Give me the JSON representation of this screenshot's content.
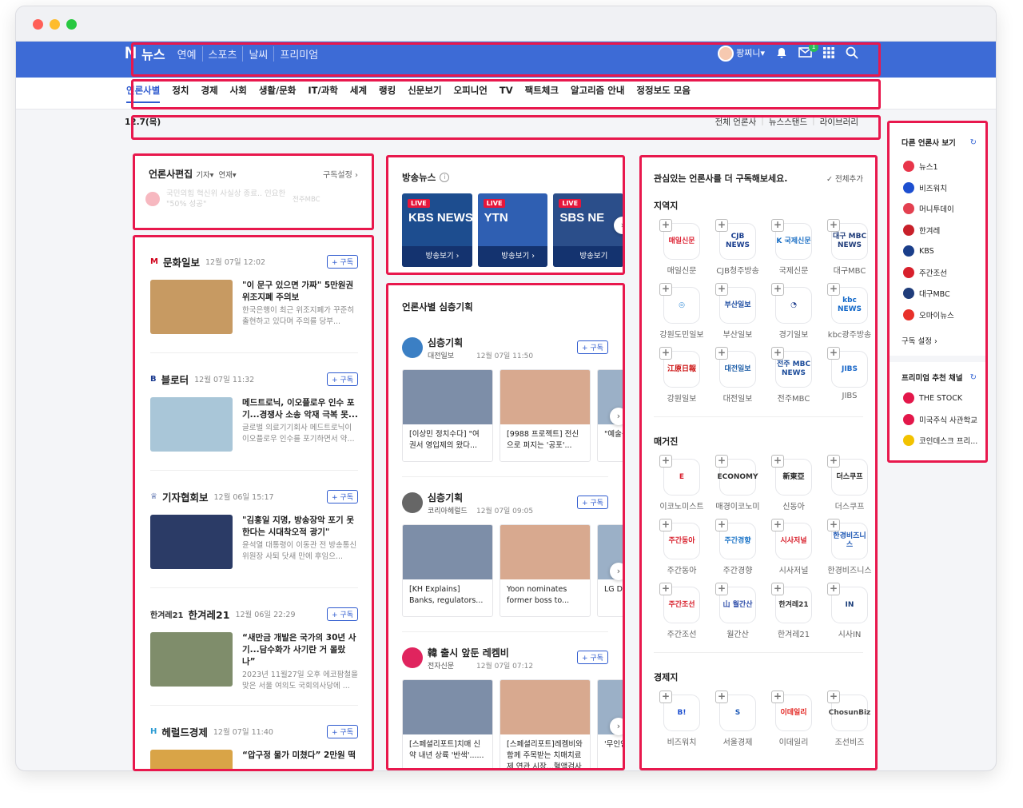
{
  "header": {
    "logo": "N",
    "service": "뉴스",
    "nav": [
      "연예",
      "스포츠",
      "날씨",
      "프리미엄"
    ],
    "user": "팡찌니▾",
    "mail_count": "1"
  },
  "categories": [
    "언론사별",
    "정치",
    "경제",
    "사회",
    "생활/문화",
    "IT/과학",
    "세계",
    "랭킹",
    "신문보기",
    "오피니언",
    "TV",
    "팩트체크",
    "알고리즘 안내",
    "정정보도 모음"
  ],
  "date": "12.7(목)",
  "date_links": [
    "전체 언론사",
    "뉴스스탠드",
    "라이브러리"
  ],
  "editor": {
    "title": "언론사편집",
    "filter1": "기자▾",
    "filter2": "연재▾",
    "settings": "구독설정 ›",
    "faded_text": "국민의힘 혁신위 사실상 종료.. 인요한 \"50% 성공\"",
    "faded_source": "전주MBC"
  },
  "subscribe_label": "+ 구독",
  "press_feed": [
    {
      "name": "문화일보",
      "time": "12월 07일 12:02",
      "title": "\"이 문구 있으면 가짜\" 5만원권 위조지폐 주의보",
      "summary": "한국은행이 최근 위조지폐가 꾸준히 출현하고 있다며 주의를 당부...",
      "thumb": "#c79a62",
      "logo": "M",
      "logo_color": "#d0021b"
    },
    {
      "name": "블로터",
      "time": "12월 07일 11:32",
      "title": "메드트로닉, 이오플로우 인수 포기...경쟁사 소송 악재 극복 못...",
      "summary": "글로벌 의료기기회사 메드트로닉이 이오플로우 인수를 포기하면서 약...",
      "thumb": "#a9c6d8",
      "logo": "B",
      "logo_color": "#1a3a8f"
    },
    {
      "name": "기자협회보",
      "time": "12월 06일 15:17",
      "title": "\"김홍일 지명, 방송장악 포기 못한다는 시대착오적 광기\"",
      "summary": "윤석열 대통령이 이동관 전 방송통신위원장 사퇴 닷새 만에 후임으...",
      "thumb": "#2b3b66",
      "logo": "♕",
      "logo_color": "#1a3a8f"
    },
    {
      "name": "한겨레21",
      "time": "12월 06일 22:29",
      "title": "“새만금 개발은 국가의 30년 사기...담수화가 사기란 거 몰랐나”",
      "summary": "2023년 11월27일 오후 에코팜철을 맞은 서울 여의도 국회의사당에 ...",
      "thumb": "#7f8d6b",
      "logo": "한겨레21",
      "logo_color": "#333"
    },
    {
      "name": "헤럴드경제",
      "time": "12월 07일 11:40",
      "title": "“압구정 물가 미쳤다” 2만원 떡",
      "summary": "",
      "thumb": "#d9a447",
      "logo": "H",
      "logo_color": "#2b9bd3"
    }
  ],
  "broadcast": {
    "title": "방송뉴스",
    "items": [
      {
        "ch": "KBS NEWS",
        "label": "방송보기 ›",
        "live": "LIVE",
        "color": "#1d4d8f"
      },
      {
        "ch": "YTN",
        "label": "방송보기 ›",
        "live": "LIVE",
        "color": "#2f5fb2"
      },
      {
        "ch": "SBS NE",
        "label": "방송보기",
        "live": "LIVE",
        "color": "#2b4e8a"
      }
    ]
  },
  "deep": {
    "title": "언론사별 심층기획",
    "groups": [
      {
        "name": "심층기획",
        "press": "대전일보",
        "time": "12월 07일 11:50",
        "items": [
          "[이상민 정치수다] \"여권서 영입제의 왔다...",
          "[9988 프로젝트] 전신으로 퍼지는 '공포'...",
          "\"예술성이"
        ],
        "logo_color": "#3b7fc4"
      },
      {
        "name": "심층기획",
        "press": "코리아헤럴드",
        "time": "12월 07일 09:05",
        "items": [
          "[KH Explains] Banks, regulators...",
          "Yoon nominates former boss to...",
          "LG Di launc"
        ],
        "logo_color": "#666"
      },
      {
        "name": "韓 출시 앞둔 레켐비",
        "press": "전자신문",
        "time": "12월 07일 07:12",
        "items": [
          "[스페셜리포트]치매 신약 내년 상륙 '반색'......",
          "[스페셜리포트]레켐비와 함께 주목받는 치매치료제 연관 시장...혈액검사·DTx 등",
          "'무인인 수CC' 가능"
        ],
        "logo_color": "#e0245e"
      }
    ]
  },
  "recommend": {
    "title": "관심있는 언론사를 더 구독해보세요.",
    "add_all": "✓ 전체추가",
    "sections": [
      {
        "name": "지역지",
        "logos": [
          {
            "name": "매일신문",
            "text": "매일신문",
            "color": "#d23"
          },
          {
            "name": "CJB청주방송",
            "text": "CJB NEWS",
            "color": "#1b3f8f"
          },
          {
            "name": "국제신문",
            "text": "K 국제신문",
            "color": "#1b6fc4"
          },
          {
            "name": "대구MBC",
            "text": "대구 MBC NEWS",
            "color": "#1f3c7a"
          },
          {
            "name": "강원도민일보",
            "text": "◎",
            "color": "#3a8fd8"
          },
          {
            "name": "부산일보",
            "text": "부산일보",
            "color": "#1a4aa0"
          },
          {
            "name": "경기일보",
            "text": "◔",
            "color": "#1e3e8e"
          },
          {
            "name": "kbc광주방송",
            "text": "kbc NEWS",
            "color": "#1469c9"
          },
          {
            "name": "강원일보",
            "text": "江原日報",
            "color": "#c11"
          },
          {
            "name": "대전일보",
            "text": "대전일보",
            "color": "#1e5ea8"
          },
          {
            "name": "전주MBC",
            "text": "전주 MBC NEWS",
            "color": "#1b4b9a"
          },
          {
            "name": "JIBS",
            "text": "JIBS",
            "color": "#1967c8"
          }
        ]
      },
      {
        "name": "매거진",
        "logos": [
          {
            "name": "이코노미스트",
            "text": "E",
            "color": "#d81e2c"
          },
          {
            "name": "매경이코노미",
            "text": "ECONOMY",
            "color": "#333"
          },
          {
            "name": "신동아",
            "text": "新東亞",
            "color": "#222"
          },
          {
            "name": "더스쿠프",
            "text": "더스쿠프",
            "color": "#222"
          },
          {
            "name": "주간동아",
            "text": "주간동아",
            "color": "#d8202c"
          },
          {
            "name": "주간경향",
            "text": "주간경향",
            "color": "#1a73c7"
          },
          {
            "name": "시사저널",
            "text": "시사저널",
            "color": "#d8202c"
          },
          {
            "name": "한경비즈니스",
            "text": "한경비즈니스",
            "color": "#1d57b4"
          },
          {
            "name": "주간조선",
            "text": "주간조선",
            "color": "#d8202c"
          },
          {
            "name": "월간산",
            "text": "山 월간산",
            "color": "#2a4aa8"
          },
          {
            "name": "한겨레21",
            "text": "한겨레21",
            "color": "#333"
          },
          {
            "name": "시사IN",
            "text": "IN",
            "color": "#1b3e7a"
          }
        ]
      },
      {
        "name": "경제지",
        "logos": [
          {
            "name": "비즈워치",
            "text": "B!",
            "color": "#1d4fd0"
          },
          {
            "name": "서울경제",
            "text": "S",
            "color": "#1f5bb8"
          },
          {
            "name": "이데일리",
            "text": "이데일리",
            "color": "#e3231f"
          },
          {
            "name": "조선비즈",
            "text": "ChosunBiz",
            "color": "#444"
          }
        ]
      }
    ]
  },
  "side": {
    "title": "다른 언론사 보기",
    "items": [
      {
        "name": "뉴스1",
        "color": "#e8354a"
      },
      {
        "name": "비즈워치",
        "color": "#1d4fd0"
      },
      {
        "name": "머니투데이",
        "color": "#e34050"
      },
      {
        "name": "한겨레",
        "color": "#c8202a"
      },
      {
        "name": "KBS",
        "color": "#1a3e8a"
      },
      {
        "name": "주간조선",
        "color": "#d8202c"
      },
      {
        "name": "대구MBC",
        "color": "#1f3c7a"
      },
      {
        "name": "오마이뉴스",
        "color": "#e8312a"
      }
    ],
    "settings": "구독 설정 ›",
    "premium_title": "프리미엄 추천 채널",
    "premium": [
      {
        "name": "THE STOCK",
        "color": "#e3174a"
      },
      {
        "name": "미국주식 사관학교",
        "color": "#e3174a"
      },
      {
        "name": "코인데스크 프리...",
        "color": "#f2c200"
      }
    ]
  }
}
